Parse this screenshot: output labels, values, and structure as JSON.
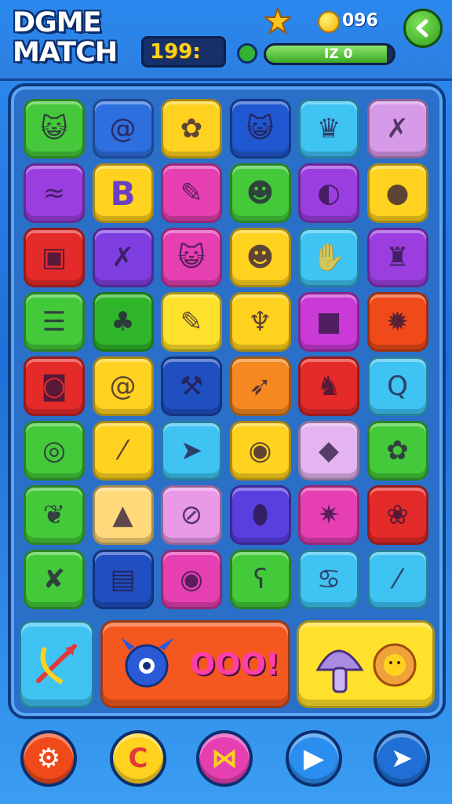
{
  "header": {
    "title_line1": "DGME",
    "title_line2": "MATCH",
    "score": "199:",
    "coins": "096",
    "progress_text": "IZ 0",
    "progress_fraction": 0.95
  },
  "grid": {
    "rows": [
      [
        {
          "icon": "cat-face-icon",
          "color": "#45c93a"
        },
        {
          "icon": "spiral-icon",
          "color": "#2e6fe0"
        },
        {
          "icon": "sun-flower-icon",
          "color": "#ffd21f"
        },
        {
          "icon": "cat-face-icon",
          "color": "#1f58d0"
        },
        {
          "icon": "crown-icon",
          "color": "#3ec3f2"
        },
        {
          "icon": "crossed-tools-icon",
          "color": "#d79ae8"
        }
      ],
      [
        {
          "icon": "whale-icon",
          "color": "#9b3ee0"
        },
        {
          "icon": "letter-b-icon",
          "color": "#ffd21f",
          "letter": "B"
        },
        {
          "icon": "pencil-leaf-icon",
          "color": "#e53fb2"
        },
        {
          "icon": "monster-face-icon",
          "color": "#43c93a"
        },
        {
          "icon": "balloon-icon",
          "color": "#9b3ee0"
        },
        {
          "icon": "blob-icon",
          "color": "#ffd21f"
        }
      ],
      [
        {
          "icon": "drum-icon",
          "color": "#e52a2a"
        },
        {
          "icon": "crossed-tools-icon",
          "color": "#7f3fe0"
        },
        {
          "icon": "cat-face-icon",
          "color": "#e53fb2"
        },
        {
          "icon": "monster-face-icon",
          "color": "#ffd21f"
        },
        {
          "icon": "mitten-icon",
          "color": "#3ec3f2"
        },
        {
          "icon": "robot-icon",
          "color": "#9b3ee0"
        }
      ],
      [
        {
          "icon": "notebook-icon",
          "color": "#43c93a"
        },
        {
          "icon": "leaf-sprout-icon",
          "color": "#2fb52a"
        },
        {
          "icon": "pencil-icon",
          "color": "#ffe02a"
        },
        {
          "icon": "cactus-icon",
          "color": "#ffd21f"
        },
        {
          "icon": "square-block-icon",
          "color": "#c93ad6"
        },
        {
          "icon": "gear-icon",
          "color": "#f04a1a"
        }
      ],
      [
        {
          "icon": "camera-icon",
          "color": "#e52a2a"
        },
        {
          "icon": "snail-icon",
          "color": "#ffd21f"
        },
        {
          "icon": "pickaxe-icon",
          "color": "#1f4fc0"
        },
        {
          "icon": "rocket-icon",
          "color": "#f5891f"
        },
        {
          "icon": "fox-icon",
          "color": "#e52a2a"
        },
        {
          "icon": "letter-q-icon",
          "color": "#3ec3f2"
        }
      ],
      [
        {
          "icon": "swirl-icon",
          "color": "#43c93a"
        },
        {
          "icon": "brush-icon",
          "color": "#ffd21f"
        },
        {
          "icon": "arrow-icon",
          "color": "#3ec3f2"
        },
        {
          "icon": "shell-icon",
          "color": "#ffd21f"
        },
        {
          "icon": "gem-icon",
          "color": "#e3b4f0"
        },
        {
          "icon": "sun-flower-icon",
          "color": "#43c93a"
        }
      ],
      [
        {
          "icon": "leaf-icon",
          "color": "#43c93a"
        },
        {
          "icon": "ghost-icon",
          "color": "#ffd97a"
        },
        {
          "icon": "ring-icon",
          "color": "#e89ae8"
        },
        {
          "icon": "egg-icon",
          "color": "#5a3fe0"
        },
        {
          "icon": "star-icon",
          "color": "#e53fb2"
        },
        {
          "icon": "flower-icon",
          "color": "#e52a2a"
        }
      ],
      [
        {
          "icon": "arrow-cross-icon",
          "color": "#43c93a"
        },
        {
          "icon": "trash-can-icon",
          "color": "#1f4fc0"
        },
        {
          "icon": "shell-icon",
          "color": "#e53fb2"
        },
        {
          "icon": "bear-face-icon",
          "color": "#43c93a"
        },
        {
          "icon": "devil-face-icon",
          "color": "#3ec3f2"
        },
        {
          "icon": "crayon-icon",
          "color": "#3ec3f2"
        }
      ]
    ]
  },
  "big_tiles": [
    {
      "icon": "bow-arrow-icon",
      "color": "#3ec3f2"
    },
    {
      "icon": "monster-combo-icon",
      "color": "#f5581f",
      "text": "OOO!"
    },
    {
      "icon": "mushroom-flower-icon",
      "color": "#ffe02a"
    }
  ],
  "bottom_buttons": [
    {
      "icon": "settings-gear-icon",
      "color": "#f04a1a",
      "glyph": "⚙"
    },
    {
      "icon": "coin-c-icon",
      "color": "#ffd21f",
      "glyph": "C"
    },
    {
      "icon": "bow-tie-icon",
      "color": "#e53fb2",
      "glyph": "⋈"
    },
    {
      "icon": "play-square-icon",
      "color": "#2a8ef0",
      "glyph": "▶"
    },
    {
      "icon": "next-arrow-icon",
      "color": "#1f6fd6",
      "glyph": "➤"
    }
  ]
}
